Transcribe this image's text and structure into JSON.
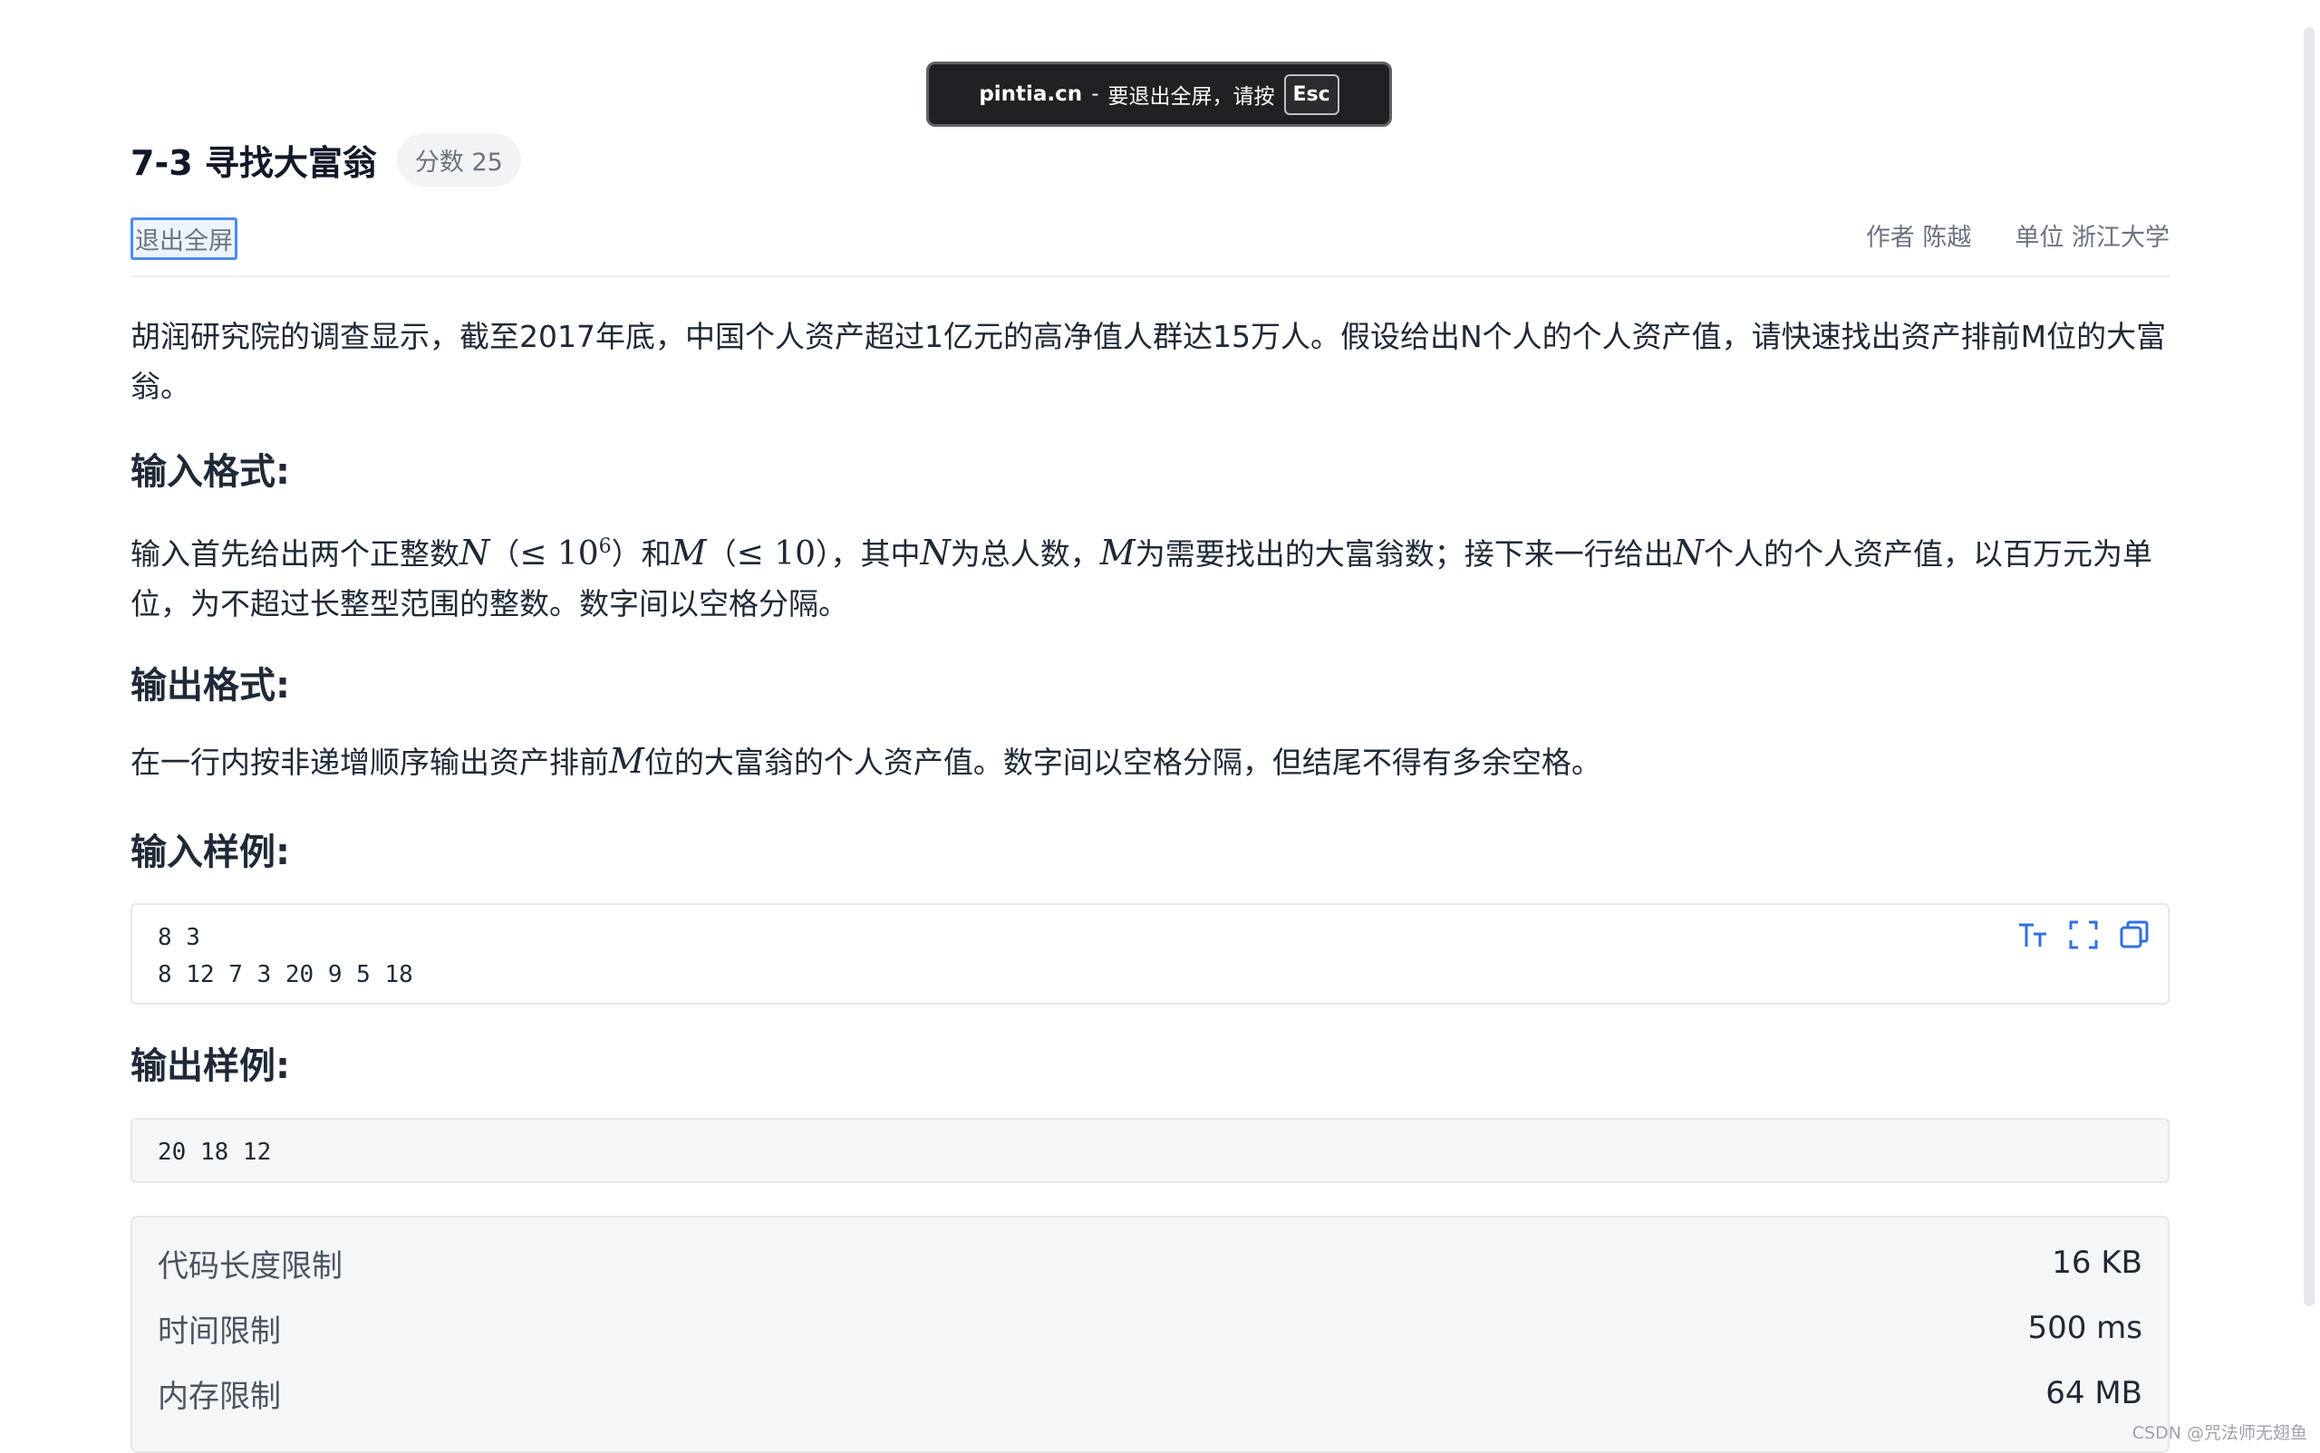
{
  "fullscreen_toast": {
    "host": "pintia.cn",
    "separator": "-",
    "message": "要退出全屏，请按",
    "key": "Esc"
  },
  "problem": {
    "title": "7-3 寻找大富翁",
    "score": "分数 25",
    "exit_fullscreen": "退出全屏",
    "author": "作者 陈越",
    "unit": "单位 浙江大学"
  },
  "description": "胡润研究院的调查显示，截至2017年底，中国个人资产超过1亿元的高净值人群达15万人。假设给出N个人的个人资产值，请快速找出资产排前M位的大富翁。",
  "input_format": {
    "heading": "输入格式:",
    "t1": "输入首先给出两个正整数",
    "N": "N",
    "c1_open": "（",
    "le": "≤ 10",
    "exp": "6",
    "c1_close": "）",
    "and": "和",
    "M": "M",
    "c2_open": "（",
    "le10": "≤ 10",
    "c2_close": "）",
    "t2": "，其中",
    "t3": "为总人数，",
    "t4": "为需要找出的大富翁数；接下来一行给出",
    "t5": "个人的个人资产值，以百万元为单位，为不超过长整型范围的整数。数字间以空格分隔。"
  },
  "output_format": {
    "heading": "输出格式:",
    "t1": "在一行内按非递增顺序输出资产排前",
    "M": "M",
    "t2": "位的大富翁的个人资产值。数字间以空格分隔，但结尾不得有多余空格。"
  },
  "sample_input": {
    "heading": "输入样例:",
    "lines": [
      "8 3",
      "8 12 7 3 20 9 5 18"
    ],
    "tools": [
      "font-size-icon",
      "expand-icon",
      "copy-icon"
    ]
  },
  "sample_output": {
    "heading": "输出样例:",
    "lines": [
      "20 18 12"
    ]
  },
  "limits": [
    {
      "label": "代码长度限制",
      "value": "16 KB"
    },
    {
      "label": "时间限制",
      "value": "500 ms"
    },
    {
      "label": "内存限制",
      "value": "64 MB"
    }
  ],
  "watermark": "CSDN @咒法师无翅鱼",
  "colors": {
    "accent": "#2f6fe8",
    "toast_bg": "#202124"
  }
}
